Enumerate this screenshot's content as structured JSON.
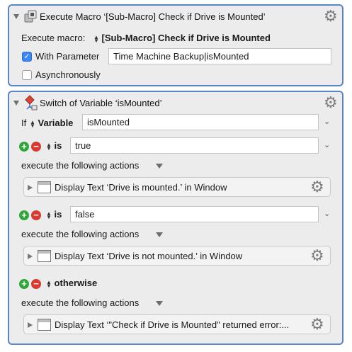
{
  "execute_macro": {
    "title": "Execute Macro ‘[Sub-Macro] Check if Drive is Mounted’",
    "execute_label": "Execute macro:",
    "macro_name": "[Sub-Macro] Check if Drive is Mounted",
    "with_parameter_label": "With Parameter",
    "with_parameter_checked": true,
    "parameter_value": "Time Machine Backup|isMounted",
    "async_label": "Asynchronously",
    "async_checked": false
  },
  "switch": {
    "title": "Switch of Variable ‘isMounted’",
    "if_label": "If",
    "source_label": "Variable",
    "variable_value": "isMounted",
    "cases": [
      {
        "operator": "is",
        "value": "true",
        "execute_label": "execute the following actions",
        "action": "Display Text ‘Drive is mounted.’ in Window"
      },
      {
        "operator": "is",
        "value": "false",
        "execute_label": "execute the following actions",
        "action": "Display Text ‘Drive is not mounted.’ in Window"
      },
      {
        "operator": "otherwise",
        "execute_label": "execute the following actions",
        "action": "Display Text ‘\"Check if Drive is Mounted\" returned error:..."
      }
    ]
  },
  "icons": {
    "gear": "gear-icon",
    "disclosure": "disclosure-triangle-icon",
    "macro": "execute-macro-icon",
    "switch": "switch-icon",
    "window": "display-window-icon"
  },
  "colors": {
    "panel_border": "#5c85c9",
    "panel_bg": "#ececec",
    "checkbox_on": "#3b87f7",
    "add": "#36a43e",
    "remove": "#d73933"
  }
}
